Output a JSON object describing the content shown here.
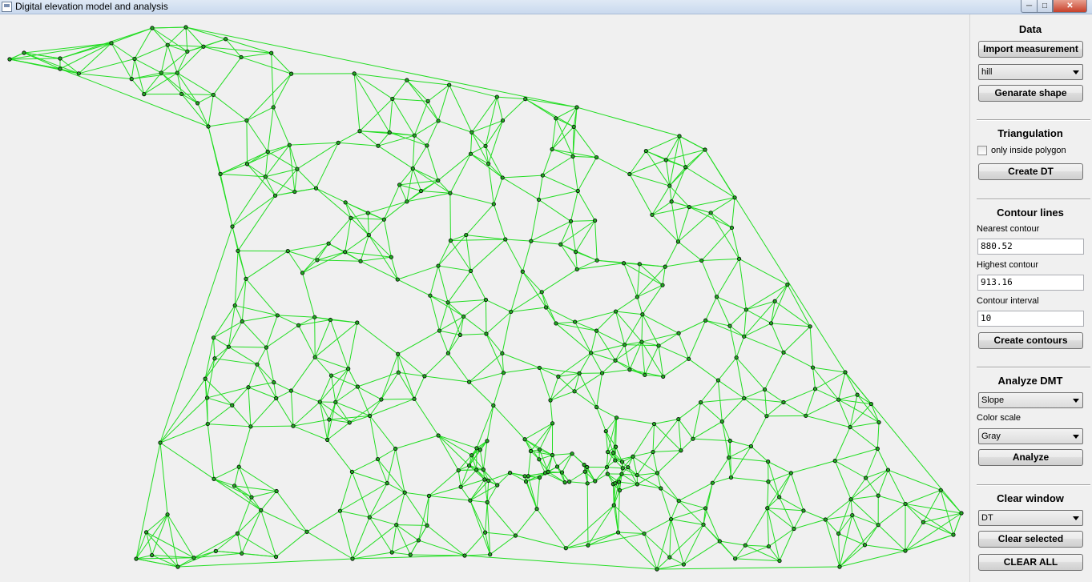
{
  "window": {
    "title": "Digital elevation model and analysis",
    "min_icon": "minimize-icon",
    "max_icon": "maximize-icon",
    "close_icon": "close-icon"
  },
  "colors": {
    "triangulation_edge": "#22dd22",
    "point_fill": "#22aa22",
    "point_stroke": "#000000"
  },
  "data_section": {
    "title": "Data",
    "import_label": "Import measurement",
    "dataset_selected": "hill",
    "generate_label": "Genarate shape"
  },
  "triangulation_section": {
    "title": "Triangulation",
    "checkbox_label": "only inside polygon",
    "checkbox_checked": false,
    "create_label": "Create DT"
  },
  "contour_section": {
    "title": "Contour lines",
    "nearest_label": "Nearest contour",
    "nearest_value": "880.52",
    "highest_label": "Highest contour",
    "highest_value": "913.16",
    "interval_label": "Contour interval",
    "interval_value": "10",
    "create_label": "Create contours"
  },
  "analyze_section": {
    "title": "Analyze DMT",
    "analysis_selected": "Slope",
    "color_scale_label": "Color scale",
    "color_scale_selected": "Gray",
    "analyze_label": "Analyze"
  },
  "clear_section": {
    "title": "Clear window",
    "clear_selected": "DT",
    "clear_selected_label": "Clear selected",
    "clear_all_label": "CLEAR ALL"
  }
}
